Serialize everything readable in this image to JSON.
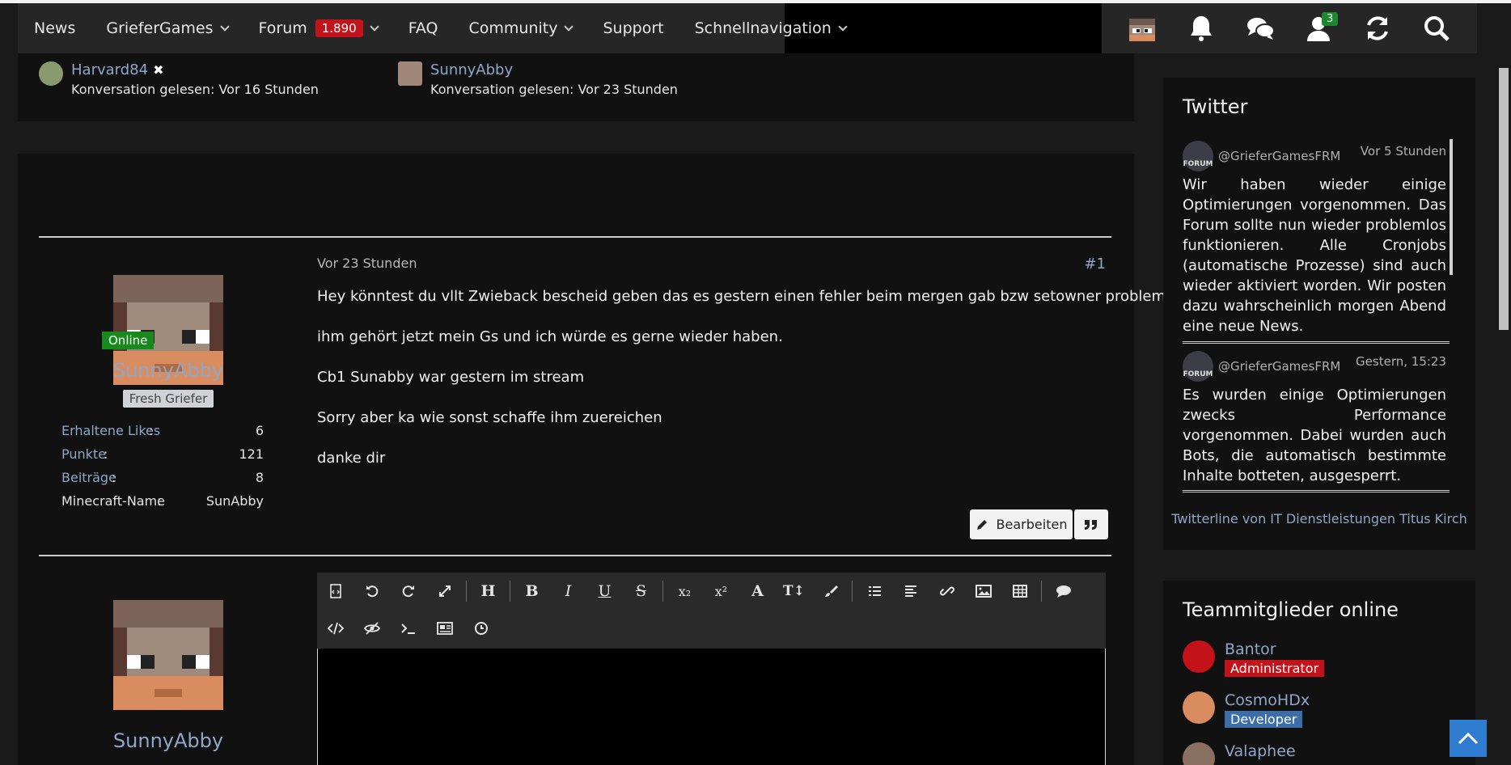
{
  "nav": {
    "items": [
      {
        "label": "News",
        "dropdown": false
      },
      {
        "label": "GrieferGames",
        "dropdown": true
      },
      {
        "label": "Forum",
        "dropdown": true,
        "badge": "1.890"
      },
      {
        "label": "FAQ",
        "dropdown": false
      },
      {
        "label": "Community",
        "dropdown": true
      },
      {
        "label": "Support",
        "dropdown": false
      },
      {
        "label": "Schnellnavigation",
        "dropdown": true
      }
    ],
    "right_icons": [
      "user-avatar-icon",
      "bell-icon",
      "chat-icon",
      "user-icon",
      "refresh-icon",
      "search-icon"
    ],
    "user_badge": "3"
  },
  "readers": [
    {
      "name": "Harvard84",
      "status": "Konversation gelesen: Vor 16 Stunden",
      "removable": true
    },
    {
      "name": "SunnyAbby",
      "status": "Konversation gelesen: Vor 23 Stunden",
      "removable": false
    }
  ],
  "post": {
    "time": "Vor 23 Stunden",
    "number": "#1",
    "author": "SunnyAbby",
    "online_label": "Online",
    "rank": "Fresh Griefer",
    "stats": [
      {
        "label": "Erhaltene Likes",
        "value": "6",
        "link": true
      },
      {
        "label": "Punkte",
        "value": "121",
        "link": true
      },
      {
        "label": "Beiträge",
        "value": "8",
        "link": true
      },
      {
        "label": "Minecraft-Name",
        "value": "SunAbby",
        "link": false
      }
    ],
    "paragraphs": [
      "Hey könntest du vllt Zwieback bescheid geben das es gestern einen fehler beim mergen gab bzw setowner problem",
      "ihm gehört jetzt mein Gs und ich würde es gerne wieder haben.",
      "Cb1 Sunabby war gestern im stream",
      "Sorry aber ka wie sonst schaffe ihm zuereichen",
      "danke dir"
    ],
    "edit_label": "Bearbeiten"
  },
  "reply": {
    "author": "SunnyAbby",
    "toolbar_row1": [
      "source-icon",
      "undo-icon",
      "redo-icon",
      "fullscreen-icon",
      "|",
      "heading-icon",
      "|",
      "bold-icon",
      "italic-icon",
      "underline-icon",
      "strikethrough-icon",
      "|",
      "subscript-icon",
      "superscript-icon",
      "font-icon",
      "font-size-icon",
      "color-icon",
      "|",
      "list-icon",
      "align-icon",
      "link-icon",
      "image-icon",
      "table-icon",
      "|",
      "quote-icon"
    ],
    "toolbar_row2": [
      "code-icon",
      "spoiler-icon",
      "terminal-icon",
      "media-icon",
      "clock-icon"
    ],
    "toolbar_glyphs": {
      "heading-icon": "H",
      "bold-icon": "B",
      "italic-icon": "I",
      "underline-icon": "U",
      "strikethrough-icon": "S",
      "subscript-icon": "x₂",
      "superscript-icon": "x²",
      "font-icon": "A",
      "font-size-icon": "T↕"
    }
  },
  "twitter": {
    "title": "Twitter",
    "tweets": [
      {
        "user": "@GrieferGamesFRM",
        "time": "Vor 5 Stunden",
        "avatar_text": "FORUM",
        "text": "Wir haben wieder einige Optimierungen vorgenommen. Das Forum sollte nun wieder problemlos funktionieren. Alle Cronjobs (automatische Prozesse) sind auch wieder aktiviert worden. Wir posten dazu wahrscheinlich morgen Abend eine neue News."
      },
      {
        "user": "@GrieferGamesFRM",
        "time": "Gestern, 15:23",
        "avatar_text": "FORUM",
        "text": "Es wurden einige Optimierungen zwecks Performance vorgenommen. Dabei wurden auch Bots, die automatisch bestimmte Inhalte botteten, ausgesperrt."
      }
    ],
    "footer": "Twitterline von IT Dienstleistungen Titus Kirch"
  },
  "team": {
    "title": "Teammitglieder online",
    "members": [
      {
        "name": "Bantor",
        "role": "Administrator",
        "role_color": "#c4121b"
      },
      {
        "name": "CosmoHDx",
        "role": "Developer",
        "role_color": "#3b6ea8"
      },
      {
        "name": "Valaphee",
        "role": "",
        "role_color": ""
      }
    ]
  }
}
